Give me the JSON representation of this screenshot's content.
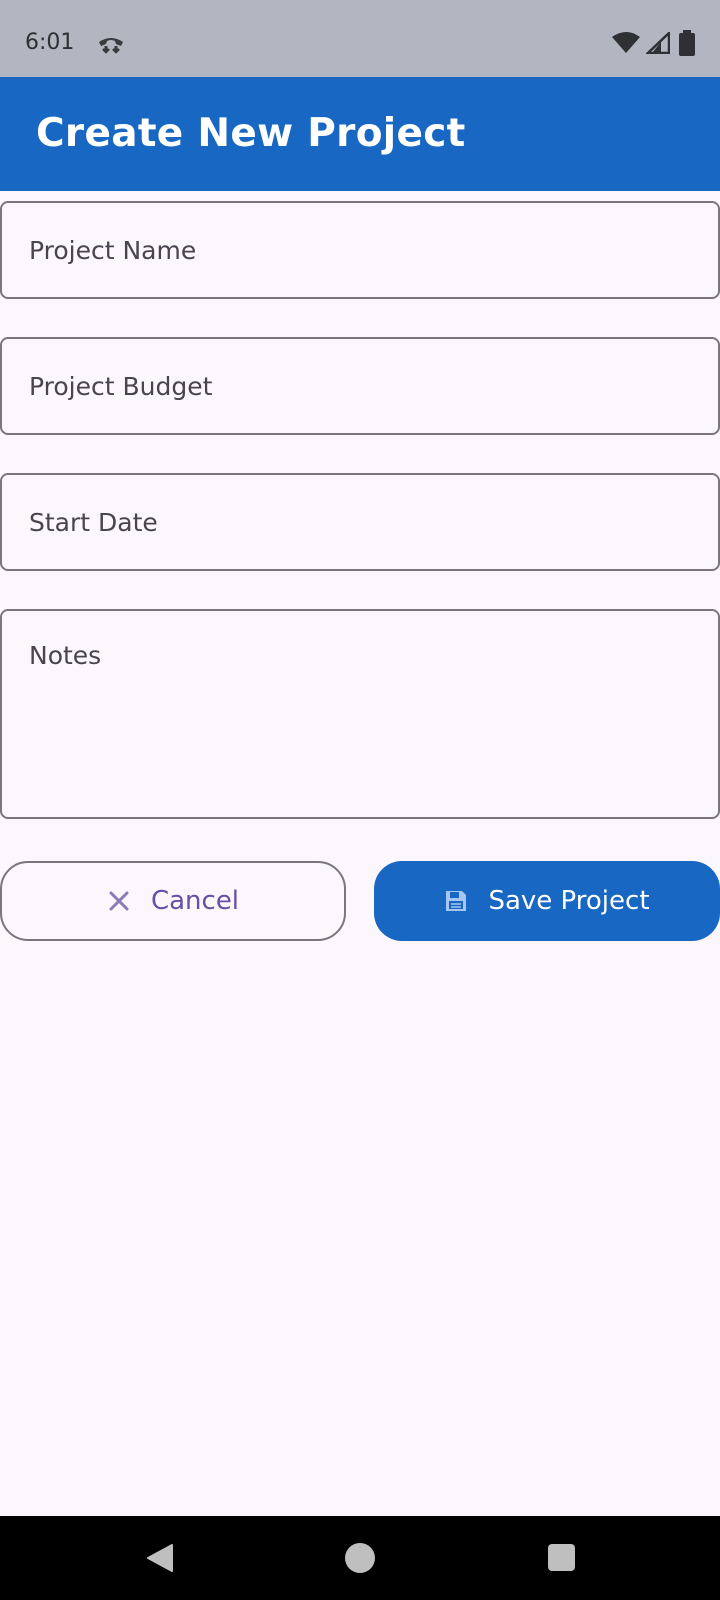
{
  "status_bar": {
    "time": "6:01",
    "icons": [
      "call-end-icon",
      "wifi-icon",
      "signal-icon",
      "battery-icon"
    ]
  },
  "app_bar": {
    "title": "Create New Project",
    "color": "#1767c3"
  },
  "form": {
    "project_name_label": "Project Name",
    "project_budget_label": "Project Budget",
    "start_date_label": "Start Date",
    "notes_label": "Notes"
  },
  "actions": {
    "cancel_label": "Cancel",
    "cancel_icon": "close-icon",
    "save_label": "Save Project",
    "save_icon": "save-icon"
  },
  "nav_bar": {
    "icons": [
      "back-icon",
      "home-icon",
      "recents-icon"
    ]
  }
}
